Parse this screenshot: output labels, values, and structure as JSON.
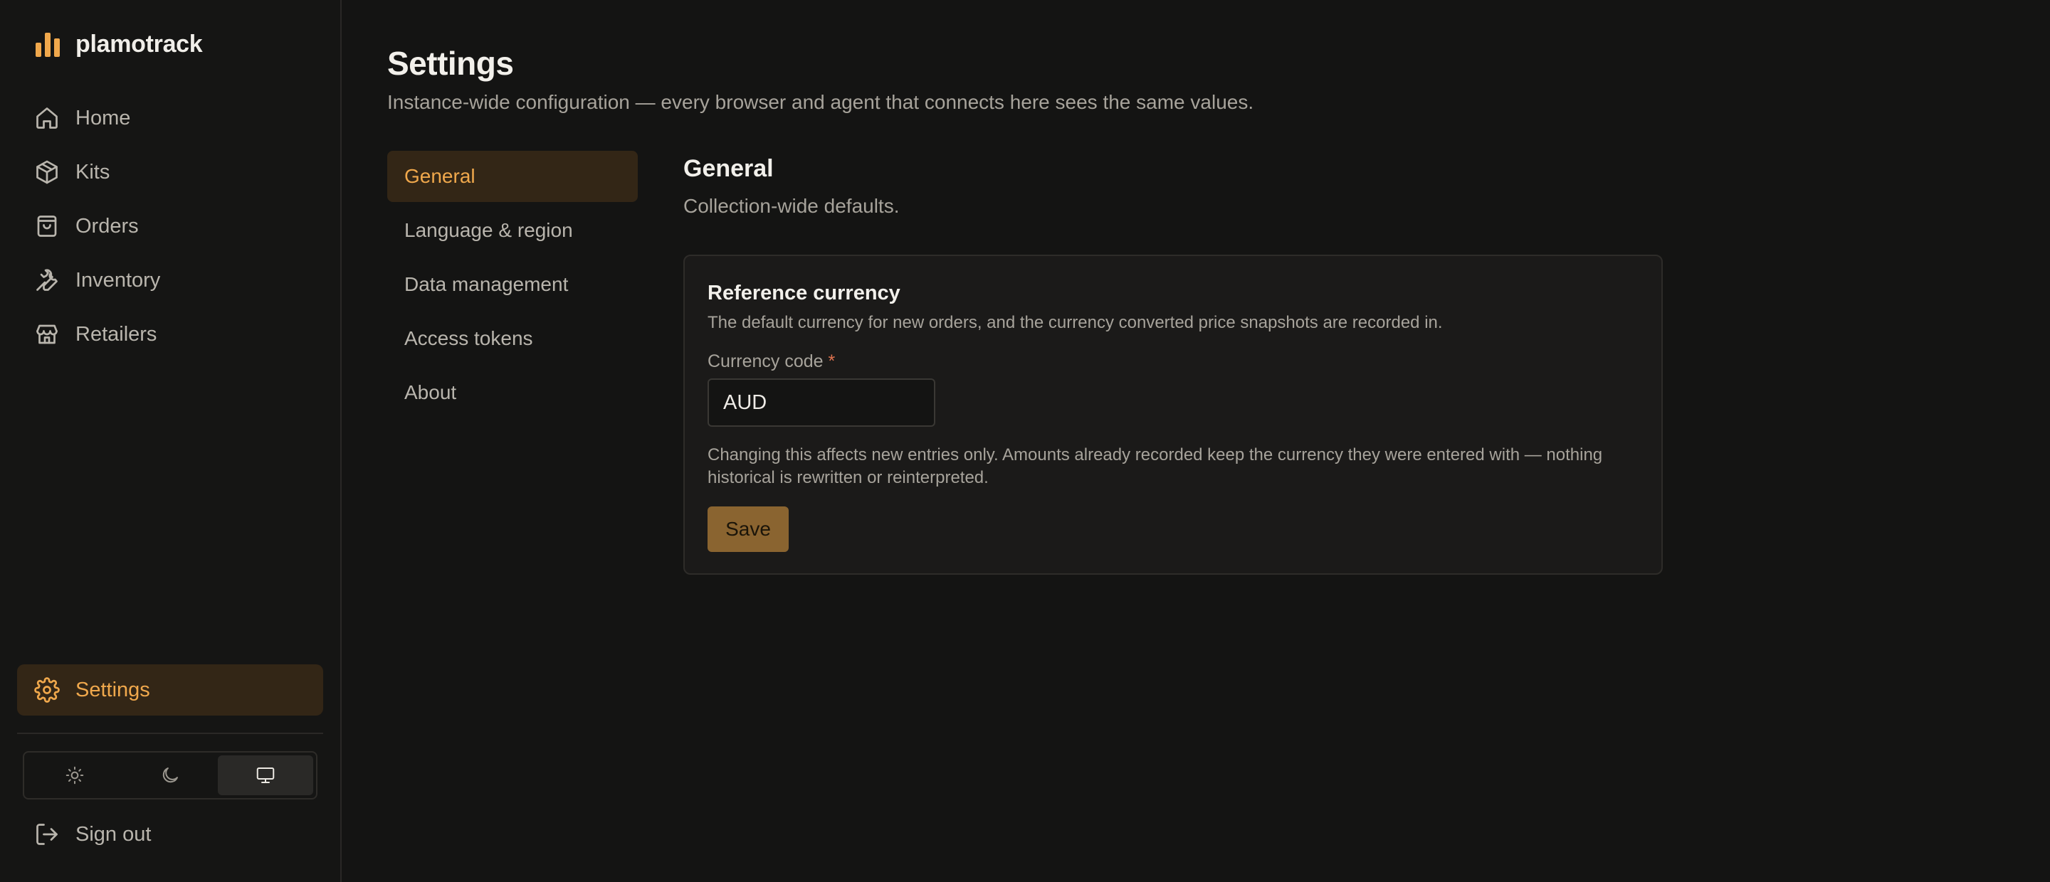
{
  "brand": {
    "name": "plamotrack",
    "icon": "bar-chart-logo-icon",
    "accent": "#f0a84c"
  },
  "sidebar": {
    "items": [
      {
        "label": "Home",
        "icon": "home-icon"
      },
      {
        "label": "Kits",
        "icon": "box-icon"
      },
      {
        "label": "Orders",
        "icon": "shopping-bag-icon"
      },
      {
        "label": "Inventory",
        "icon": "wrench-icon"
      },
      {
        "label": "Retailers",
        "icon": "store-icon"
      }
    ],
    "settings": {
      "label": "Settings",
      "icon": "gear-icon",
      "active": true
    },
    "theme": {
      "options": [
        "light",
        "dark",
        "system"
      ],
      "selected": "system"
    },
    "signout": {
      "label": "Sign out",
      "icon": "logout-icon"
    }
  },
  "page": {
    "title": "Settings",
    "subtitle": "Instance-wide configuration — every browser and agent that connects here sees the same values."
  },
  "subnav": {
    "items": [
      "General",
      "Language & region",
      "Data management",
      "Access tokens",
      "About"
    ],
    "active": "General"
  },
  "section": {
    "title": "General",
    "subtitle": "Collection-wide defaults."
  },
  "card": {
    "title": "Reference currency",
    "description": "The default currency for new orders, and the currency converted price snapshots are recorded in.",
    "field_label": "Currency code",
    "required_marker": "*",
    "value": "AUD",
    "note": "Changing this affects new entries only. Amounts already recorded keep the currency they were entered with — nothing historical is rewritten or reinterpreted.",
    "save_label": "Save"
  }
}
